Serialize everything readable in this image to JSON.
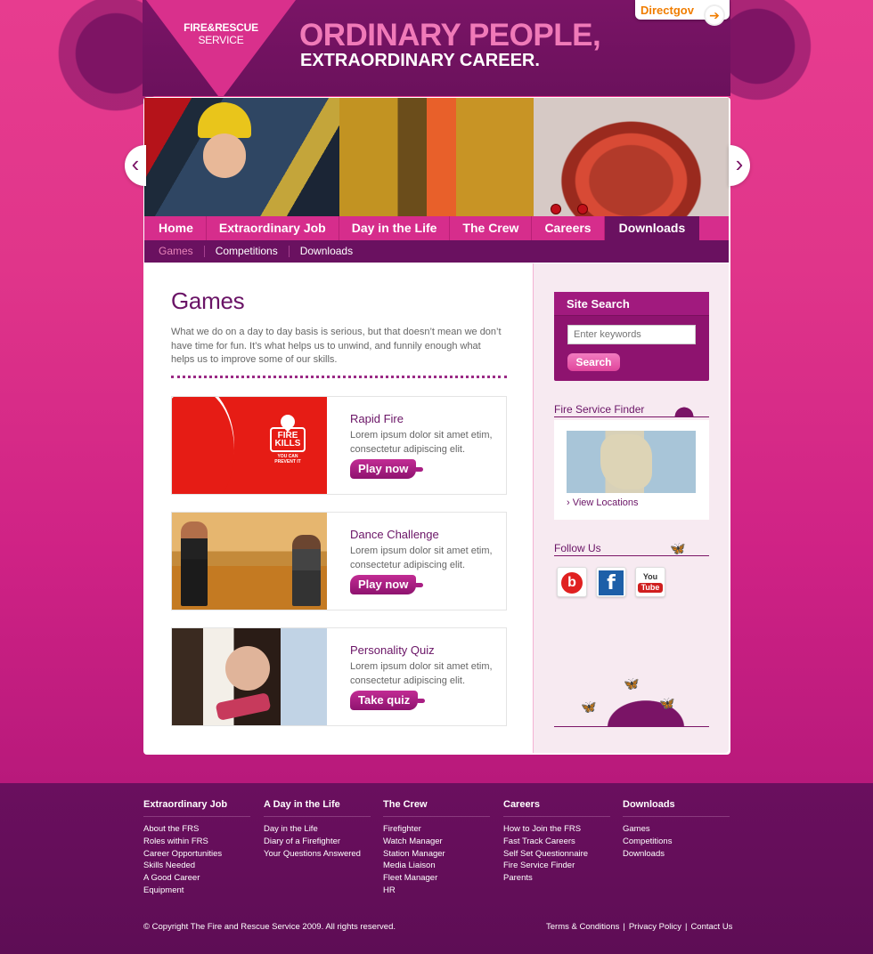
{
  "header": {
    "logo_line1": "FIRE&RESCUE",
    "logo_line2": "SERVICE",
    "tagline_1": "ORDINARY PEOPLE,",
    "tagline_2": "EXTRAORDINARY CAREER.",
    "directgov_label": "Directgov",
    "directgov_icon": "arrow-circle-icon"
  },
  "slider": {
    "prev_label": "‹",
    "next_label": "›"
  },
  "nav": {
    "items": [
      "Home",
      "Extraordinary Job",
      "Day in the Life",
      "The Crew",
      "Careers",
      "Downloads"
    ],
    "active": "Downloads"
  },
  "subnav": {
    "items": [
      "Games",
      "Competitions",
      "Downloads"
    ],
    "active": "Games"
  },
  "main": {
    "title": "Games",
    "intro": "What we do on a day to day basis is serious, but that doesn’t mean we don’t have time for fun. It’s what helps us to unwind, and funnily enough what helps us to improve some of our skills.",
    "games": [
      {
        "title": "Rapid Fire",
        "desc": "Lorem ipsum dolor sit amet etim, consectetur adipiscing elit.",
        "button": "Play now"
      },
      {
        "title": "Dance Challenge",
        "desc": "Lorem ipsum dolor sit amet etim, consectetur adipiscing elit.",
        "button": "Play now"
      },
      {
        "title": "Personality Quiz",
        "desc": "Lorem ipsum dolor sit amet etim, consectetur adipiscing elit.",
        "button": "Take quiz"
      }
    ],
    "firekills": {
      "line1": "FIRE",
      "line2": "KILLS",
      "line3": "YOU CAN PREVENT IT"
    }
  },
  "sidebar": {
    "search": {
      "title": "Site Search",
      "placeholder": "Enter keywords",
      "button": "Search"
    },
    "finder": {
      "title": "Fire Service Finder",
      "link": "› View Locations"
    },
    "follow": {
      "title": "Follow Us",
      "bebo": "b",
      "facebook": "f",
      "youtube_top": "You",
      "youtube_bottom": "Tube"
    }
  },
  "footer": {
    "columns": [
      {
        "title": "Extraordinary Job",
        "links": [
          "About the FRS",
          "Roles within FRS",
          "Career Opportunities",
          "Skills Needed",
          "A Good Career",
          "Equipment"
        ]
      },
      {
        "title": "A Day in the Life",
        "links": [
          "Day in the Life",
          "Diary of a Firefighter",
          "Your Questions Answered"
        ]
      },
      {
        "title": "The Crew",
        "links": [
          "Firefighter",
          "Watch Manager",
          "Station Manager",
          "Media Liaison",
          "Fleet Manager",
          "HR"
        ]
      },
      {
        "title": "Careers",
        "links": [
          "How to Join the FRS",
          "Fast Track Careers",
          "Self Set Questionnaire",
          "Fire Service Finder",
          "Parents"
        ]
      },
      {
        "title": "Downloads",
        "links": [
          "Games",
          "Competitions",
          "Downloads"
        ]
      }
    ],
    "copyright": "© Copyright The Fire and Rescue Service 2009. All rights reserved.",
    "legal": [
      "Terms & Conditions",
      "Privacy Policy",
      "Contact Us"
    ],
    "separator": "|"
  }
}
